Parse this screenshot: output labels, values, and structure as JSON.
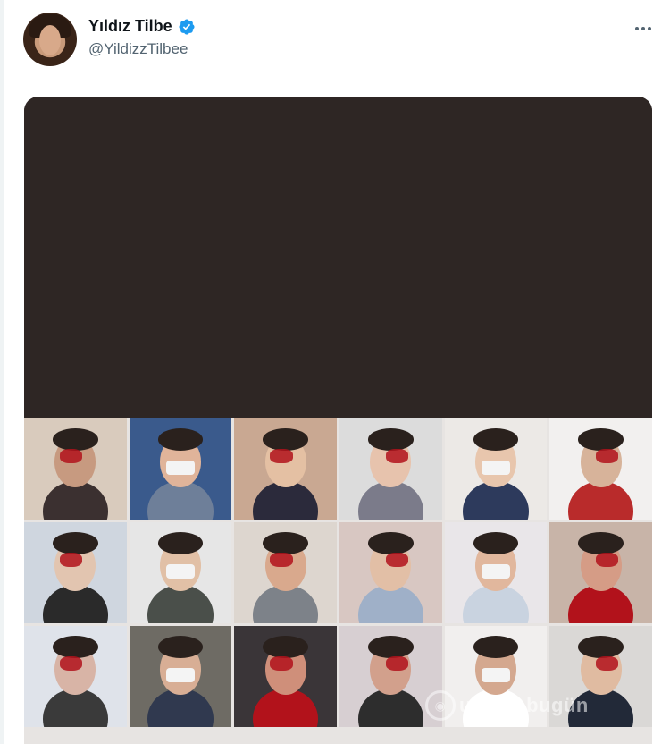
{
  "tweet": {
    "author": {
      "display_name": "Yıldız Tilbe",
      "handle": "@YildizzTilbee",
      "verified": true,
      "avatar_icon": "profile-photo",
      "badge_color": "#1d9bf0"
    },
    "more_icon": "more-horizontal-icon",
    "media": {
      "type": "photo-collage",
      "dark_panel_color": "#2e2624",
      "grid_rows": 3,
      "grid_cols": 6,
      "watermark_text": "ursadabugün"
    }
  }
}
